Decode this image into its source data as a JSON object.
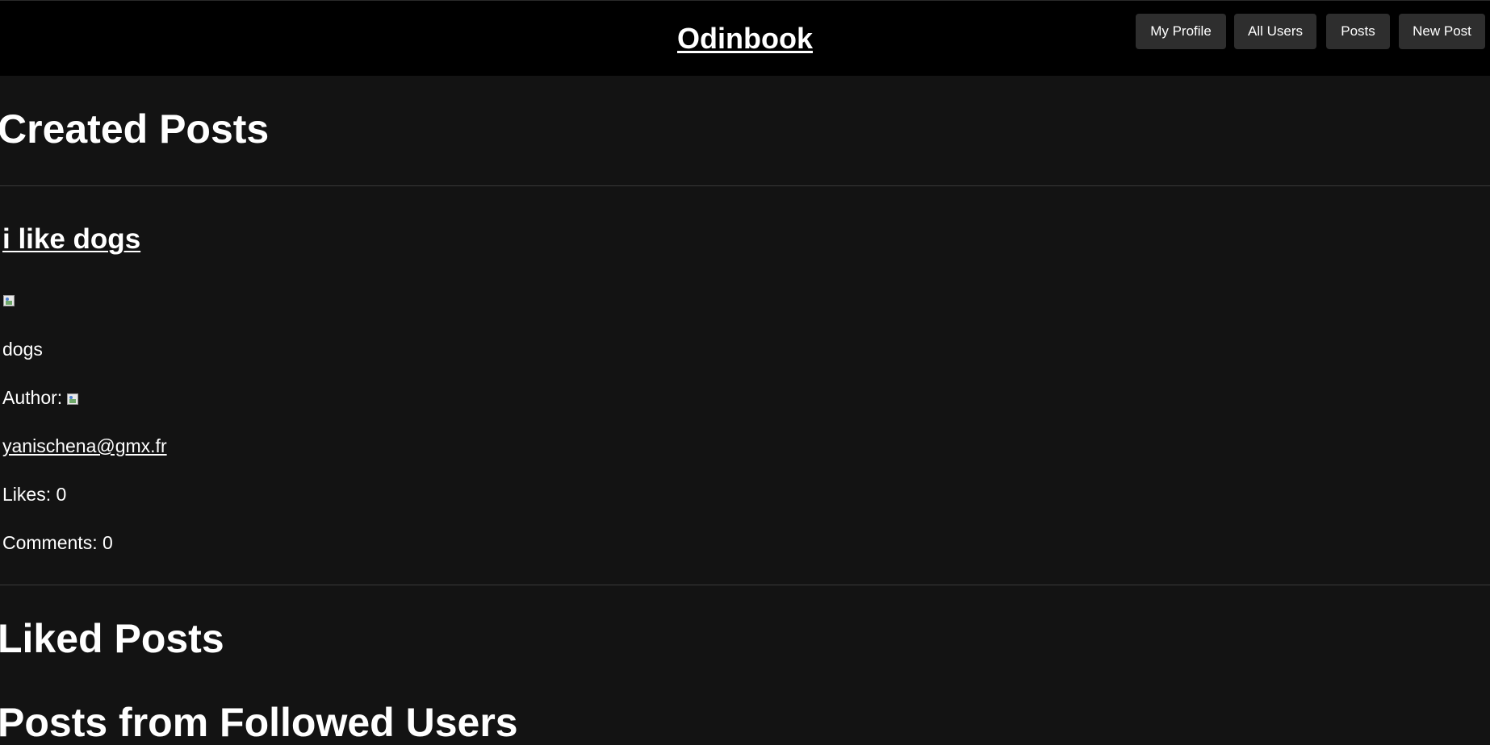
{
  "header": {
    "brand": "Odinbook",
    "nav": {
      "my_profile": "My Profile",
      "all_users": "All Users",
      "posts": "Posts",
      "new_post": "New Post"
    }
  },
  "sections": {
    "created_posts": "Created Posts",
    "liked_posts": "Liked Posts",
    "followed_posts": "Posts from Followed Users"
  },
  "post": {
    "title": "i like dogs",
    "body": "dogs",
    "author_label": "Author:",
    "author_email": "yanischena@gmx.fr",
    "likes": "Likes: 0",
    "comments": "Comments: 0"
  },
  "colors": {
    "page_background": "#131313",
    "header_background": "#000000",
    "button_background": "#2e2e2e",
    "text": "#ffffff"
  },
  "icons": {
    "post_image": "broken-image-icon",
    "author_avatar": "broken-image-icon"
  }
}
